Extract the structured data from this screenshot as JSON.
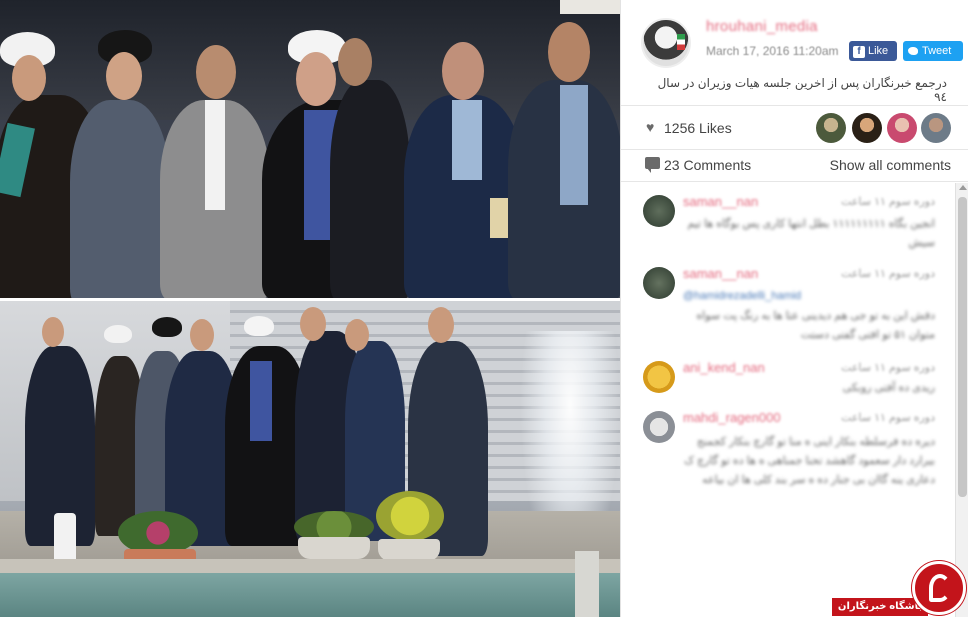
{
  "post": {
    "username": "hrouhani_media",
    "datetime": "March 17, 2016 11:20am",
    "like_button": "Like",
    "tweet_button": "Tweet",
    "caption": "درجمع خبرنگاران پس از اخرین جلسه هیات وزیران در سال ۹٤",
    "avatar_icon": "profile-avatar-icon"
  },
  "stats": {
    "likes": "1256 Likes",
    "comments": "23 Comments",
    "show_all": "Show all comments"
  },
  "comments": [
    {
      "user": "saman__nan",
      "date": "دوره سوم ۱۱ ساعت",
      "body": "انجین بگاه ۱۱۱۱۱۱۱۱۱ بطل انتها کاری پس بوگاه ها تیم سیش"
    },
    {
      "user": "saman__nan",
      "date": "دوره سوم ۱۱ ساعت",
      "mention": "@hamidrezadelli_hamid",
      "body": "دقش این به تو جی هم دیدینی عتا ها به رنگ پت سواه متوان ۵۱ تو افتی گفتی دستت"
    },
    {
      "user": "ani_kend_nan",
      "date": "دوره سوم ۱۱ ساعت",
      "body": "ریدی ده آفتی روبکی"
    },
    {
      "user": "mahdi_ragen000",
      "date": "دوره سوم ۱۱ ساعت",
      "body": "دیره ده فرسلطه بنکار اینی ه منا تو گارچ بنکار کجمنج بیرارد دار سعمود گاهشد تحنا جمناهی ه ها ده تو گارچ ک دعاری ینه گاان بی جنار ده ه سر بند کلی ها ان بیاعه"
    }
  ],
  "watermark": {
    "text": "باشگاه خبرنگاران"
  },
  "colors": {
    "username": "#e46a7f",
    "facebook": "#3b5998",
    "twitter": "#1da1f2",
    "watermark": "#c3141b"
  }
}
